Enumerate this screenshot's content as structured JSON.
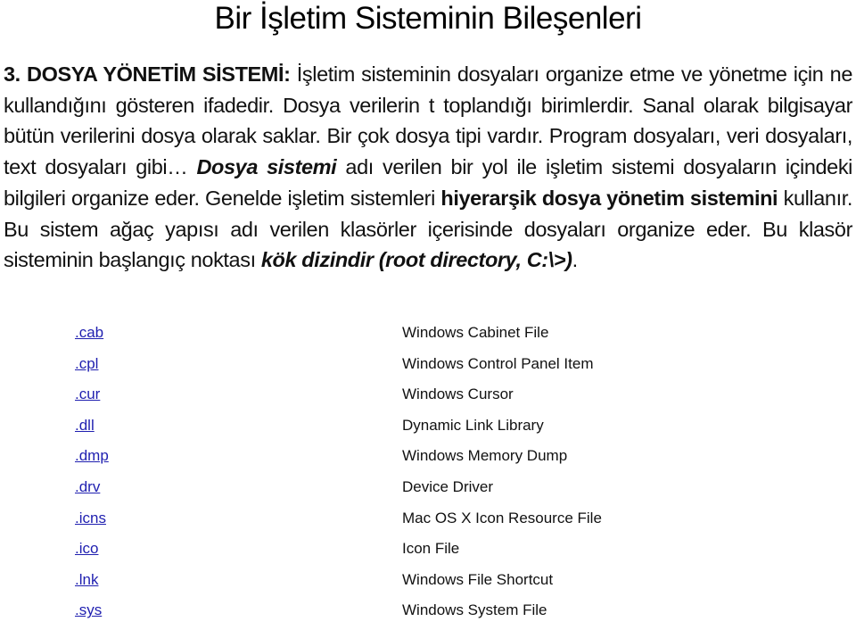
{
  "title": "Bir İşletim Sisteminin Bileşenleri",
  "paragraph": {
    "heading": "3. DOSYA YÖNETİM SİSTEMİ:",
    "text1": " İşletim sisteminin dosyaları organize etme ve yönetme için ne kullandığını gösteren ifadedir. Dosya verilerin  t toplandığı birimlerdir. Sanal olarak bilgisayar bütün verilerini dosya olarak saklar. Bir çok dosya tipi vardır. Program dosyaları, veri dosyaları, text dosyaları gibi… ",
    "emph1": "Dosya sistemi",
    "text2": " adı verilen bir yol ile işletim sistemi dosyaların içindeki bilgileri organize eder. Genelde işletim sistemleri ",
    "emph2": "hiyerarşik dosya yönetim sistemini",
    "text3": " kullanır. Bu sistem ağaç yapısı adı verilen klasörler içerisinde dosyaları organize eder. Bu klasör sisteminin başlangıç noktası ",
    "emph3": "kök dizindir (root directory, C:\\>)",
    "text4": "."
  },
  "link_color": "#1f1fb0",
  "file_types": [
    {
      "ext": ".cab",
      "desc": "Windows Cabinet File"
    },
    {
      "ext": ".cpl",
      "desc": "Windows Control Panel Item"
    },
    {
      "ext": ".cur",
      "desc": "Windows Cursor"
    },
    {
      "ext": ".dll",
      "desc": "Dynamic Link Library"
    },
    {
      "ext": ".dmp",
      "desc": "Windows Memory Dump"
    },
    {
      "ext": ".drv",
      "desc": "Device Driver"
    },
    {
      "ext": ".icns",
      "desc": "Mac OS X Icon Resource File"
    },
    {
      "ext": ".ico",
      "desc": "Icon File"
    },
    {
      "ext": ".lnk",
      "desc": "Windows File Shortcut"
    },
    {
      "ext": ".sys",
      "desc": "Windows System File"
    }
  ]
}
